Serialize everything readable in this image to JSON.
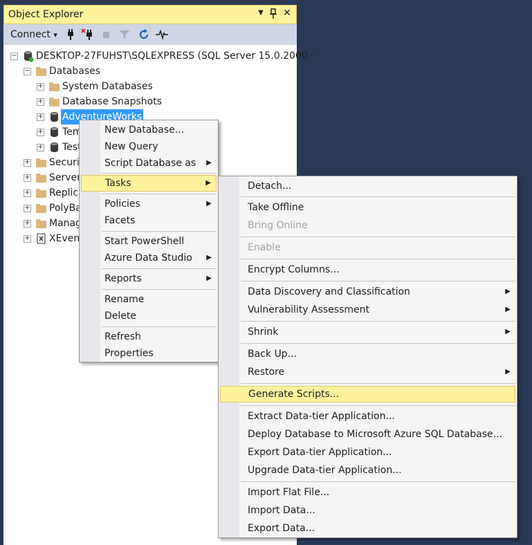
{
  "window": {
    "title": "Object Explorer",
    "dropdown_glyph": "▼",
    "pin_glyph": "╤",
    "close_glyph": "✕"
  },
  "toolbar": {
    "connect_label": "Connect",
    "connect_arrow": "▾"
  },
  "tree": {
    "server": "DESKTOP-27FUHST\\SQLEXPRESS (SQL Server 15.0.2000 -",
    "databases": "Databases",
    "system_databases": "System Databases",
    "database_snapshots": "Database Snapshots",
    "adventureworks": "AdventureWorks",
    "db_tem": "Tem",
    "db_test": "Test",
    "security": "Securit",
    "server_objects": "Server",
    "replication": "Replic",
    "polybase": "PolyBa",
    "management": "Manag",
    "xevent": "XEvent",
    "expand_glyph": "+",
    "collapse_glyph": "−"
  },
  "context_menu": {
    "new_database": "New Database...",
    "new_query": "New Query",
    "script_database_as": "Script Database as",
    "tasks": "Tasks",
    "policies": "Policies",
    "facets": "Facets",
    "start_powershell": "Start PowerShell",
    "azure_data_studio": "Azure Data Studio",
    "reports": "Reports",
    "rename": "Rename",
    "delete": "Delete",
    "refresh": "Refresh",
    "properties": "Properties",
    "submenu_arrow": "▶"
  },
  "tasks_menu": {
    "detach": "Detach...",
    "take_offline": "Take Offline",
    "bring_online": "Bring Online",
    "enable": "Enable",
    "encrypt_columns": "Encrypt Columns...",
    "data_discovery": "Data Discovery and Classification",
    "vulnerability": "Vulnerability Assessment",
    "shrink": "Shrink",
    "back_up": "Back Up...",
    "restore": "Restore",
    "generate_scripts": "Generate Scripts...",
    "extract_dac": "Extract Data-tier Application...",
    "deploy_azure": "Deploy Database to Microsoft Azure SQL Database...",
    "export_dac": "Export Data-tier Application...",
    "upgrade_dac": "Upgrade Data-tier Application...",
    "import_flat_file": "Import Flat File...",
    "import_data": "Import Data...",
    "export_data": "Export Data..."
  },
  "colors": {
    "background": "#293955",
    "title_bar": "#fff29d",
    "toolbar": "#cfd6e5",
    "selection": "#3399ff",
    "highlight": "#fff29d",
    "disabled_text": "#a2a4a5"
  }
}
